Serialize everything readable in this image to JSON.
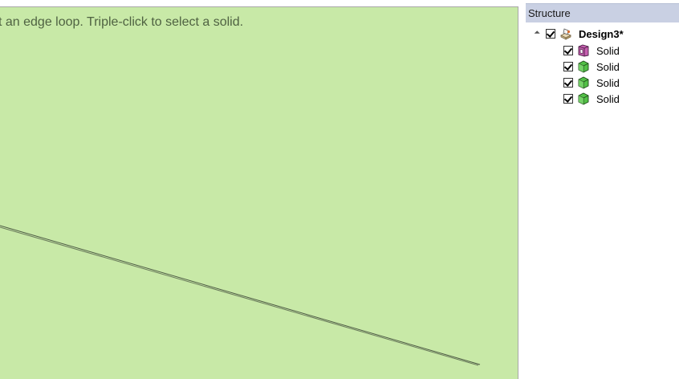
{
  "viewport": {
    "hint_text": "t an edge loop. Triple-click to select a solid.",
    "background_color": "#c8e9a7"
  },
  "structure_panel": {
    "title": "Structure",
    "root": {
      "label": "Design3*",
      "checked": true,
      "icon": "design-icon"
    },
    "items": [
      {
        "label": "Solid",
        "checked": true,
        "icon": "solid-purple-icon",
        "color": "#b14a9a"
      },
      {
        "label": "Solid",
        "checked": true,
        "icon": "solid-green-icon",
        "color": "#3fae3a"
      },
      {
        "label": "Solid",
        "checked": true,
        "icon": "solid-green-icon",
        "color": "#3fae3a"
      },
      {
        "label": "Solid",
        "checked": true,
        "icon": "solid-green-icon",
        "color": "#3fae3a"
      }
    ]
  }
}
